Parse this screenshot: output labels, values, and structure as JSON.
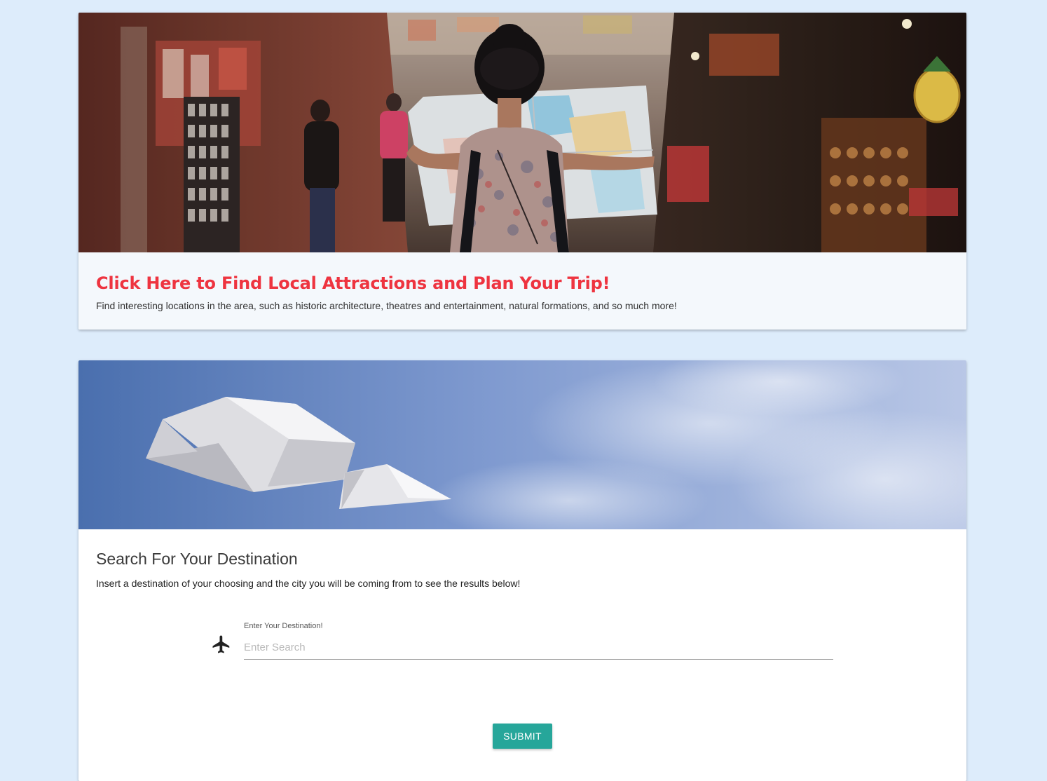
{
  "attractions_card": {
    "title": "Click Here to Find Local Attractions and Plan Your Trip!",
    "description": "Find interesting locations in the area, such as historic architecture, theatres and entertainment, natural formations, and so much more!",
    "title_color": "#ee3440",
    "image": "traveler-holding-map-in-market-street"
  },
  "search_card": {
    "image": "paper-airplane-in-blue-sky",
    "title": "Search For Your Destination",
    "description": "Insert a destination of your choosing and the city you will be coming from to see the results below!",
    "field": {
      "icon": "airplane-icon",
      "label": "Enter Your Destination!",
      "placeholder": "Enter Search",
      "value": ""
    },
    "submit_label": "SUBMIT",
    "submit_color": "#26a69a"
  },
  "page": {
    "background_color": "#ddecfb"
  }
}
